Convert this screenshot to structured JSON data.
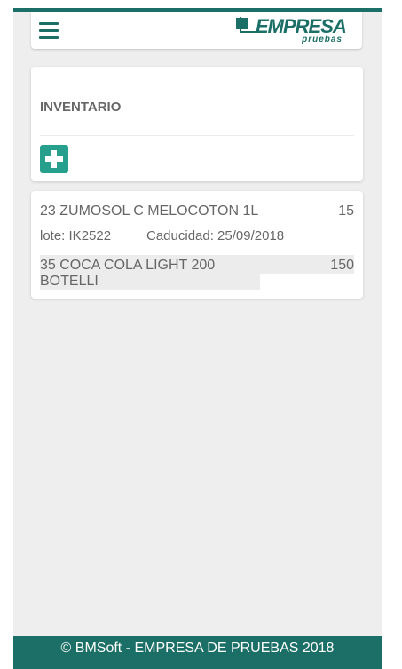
{
  "header": {
    "logo_text": "EMPRESA",
    "logo_sub": "pruebas"
  },
  "inventory": {
    "title": "INVENTARIO",
    "add_icon": "plus-icon"
  },
  "items": [
    {
      "code": "23",
      "name": "23 ZUMOSOL C MELOCOTON 1L",
      "qty": "15",
      "lote": "lote: IK2522",
      "caducidad": "Caducidad: 25/09/2018"
    },
    {
      "code": "35",
      "name": "35 COCA COLA LIGHT 200 BOTELLI",
      "qty": "150"
    }
  ],
  "footer": {
    "text": "© BMSoft - EMPRESA DE PRUEBAS 2018"
  },
  "colors": {
    "primary": "#1b6f66",
    "accent": "#26a08c",
    "background": "#eeeeee"
  }
}
